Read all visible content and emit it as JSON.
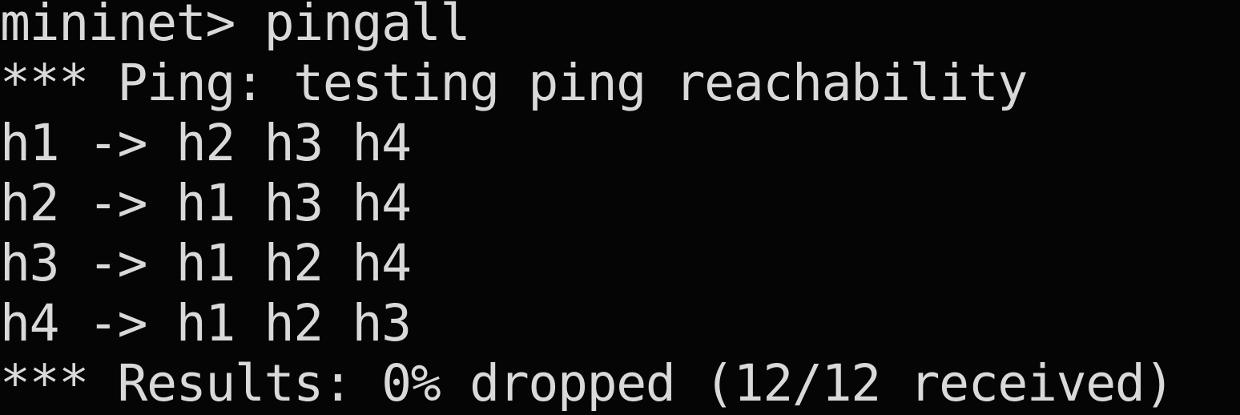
{
  "terminal": {
    "lines": [
      "mininet> pingall",
      "*** Ping: testing ping reachability",
      "h1 -> h2 h3 h4",
      "h2 -> h1 h3 h4",
      "h3 -> h1 h2 h4",
      "h4 -> h1 h2 h3",
      "*** Results: 0% dropped (12/12 received)"
    ]
  },
  "colors": {
    "background": "#050505",
    "text": "#d9d9d9"
  }
}
